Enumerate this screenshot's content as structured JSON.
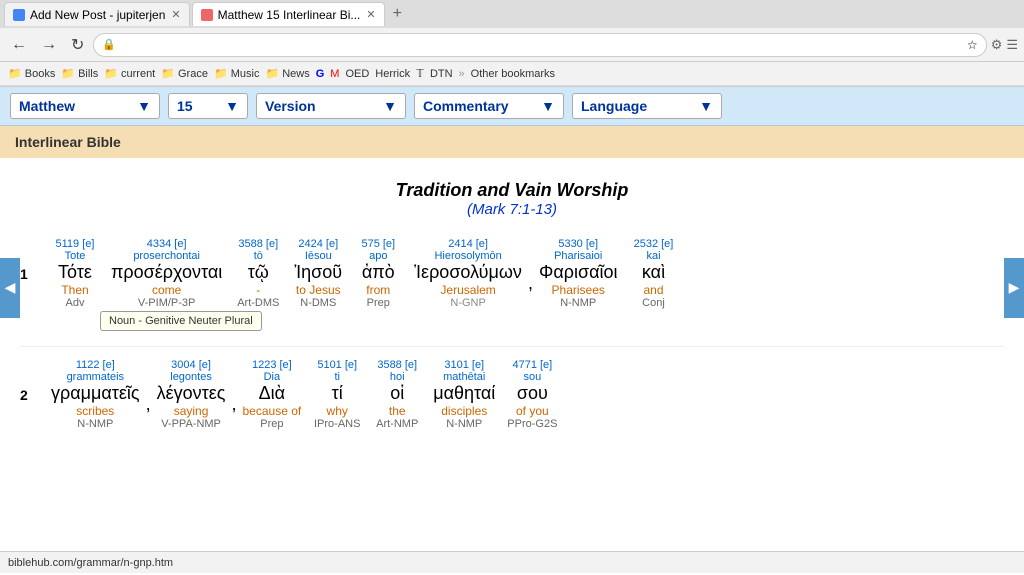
{
  "browser": {
    "tabs": [
      {
        "label": "Add New Post - jupiterjen",
        "active": false,
        "id": "tab1"
      },
      {
        "label": "Matthew 15 Interlinear Bi...",
        "active": true,
        "id": "tab2"
      }
    ],
    "address": "biblehub.com/interlinear/matthew/15.htm",
    "status_url": "biblehub.com/grammar/n-gnp.htm"
  },
  "bookmarks": [
    {
      "label": "Books"
    },
    {
      "label": "Bills"
    },
    {
      "label": "current"
    },
    {
      "label": "Grace"
    },
    {
      "label": "Music"
    },
    {
      "label": "News"
    },
    {
      "label": "OED"
    },
    {
      "label": "Herrick"
    },
    {
      "label": "DTN"
    },
    {
      "label": "Other bookmarks"
    }
  ],
  "toolbar": {
    "matthew_label": "Matthew",
    "chapter_label": "15",
    "version_label": "Version",
    "commentary_label": "Commentary",
    "language_label": "Language"
  },
  "bible_header": {
    "title": "Interlinear Bible"
  },
  "page_title": "Tradition and Vain Worship",
  "page_subtitle": "(Mark 7:1-13)",
  "verses": [
    {
      "num": "1",
      "words": [
        {
          "strongs": "5119 [e]",
          "translit": "Tote",
          "greek": "Τότε",
          "english": "Then",
          "parse": "Adv"
        },
        {
          "strongs": "4334 [e]",
          "translit": "proserchontai",
          "greek": "προσέρχονται",
          "english": "come",
          "parse": "V-PIM/P-3P"
        },
        {
          "strongs": "3588 [e]",
          "translit": "tō",
          "greek": "τῷ",
          "english": "-",
          "parse": "Art-DMS"
        },
        {
          "strongs": "2424 [e]",
          "translit": "Iēsou",
          "greek": "Ἰησοῦ",
          "english": "to Jesus",
          "parse": "N-DMS"
        },
        {
          "strongs": "575 [e]",
          "translit": "apo",
          "greek": "ἀπὸ",
          "english": "from",
          "parse": "Prep"
        },
        {
          "strongs": "2414 [e]",
          "translit": "Hierosolymōn",
          "greek": "Ἱεροσολύμων",
          "english": "Jerusalem",
          "parse": "N-GNP",
          "has_tooltip": true,
          "tooltip_text": "Noun - Genitive Neuter Plural",
          "punct": ","
        },
        {
          "strongs": "5330 [e]",
          "translit": "Pharisaioi",
          "greek": "Φαρισαῖοι",
          "english": "Pharisees",
          "parse": "N-NMP"
        },
        {
          "strongs": "2532 [e]",
          "translit": "kai",
          "greek": "καὶ",
          "english": "and",
          "parse": "Conj"
        }
      ]
    },
    {
      "num": "2",
      "words": [
        {
          "strongs": "1122 [e]",
          "translit": "grammateis",
          "greek": "γραμματεῖς",
          "english": "scribes",
          "parse": "N-NMP",
          "punct": ","
        },
        {
          "strongs": "3004 [e]",
          "translit": "legontes",
          "greek": "λέγοντες",
          "english": "saying",
          "parse": "V-PPA-NMP",
          "punct": ","
        },
        {
          "strongs": "1223 [e]",
          "translit": "Dia",
          "greek": "Διὰ",
          "english": "because of",
          "parse": "Prep"
        },
        {
          "strongs": "5101 [e]",
          "translit": "ti",
          "greek": "τί",
          "english": "why",
          "parse": "IPro-ANS"
        },
        {
          "strongs": "3588 [e]",
          "translit": "hoi",
          "greek": "οἱ",
          "english": "the",
          "parse": "Art-NMP"
        },
        {
          "strongs": "3101 [e]",
          "translit": "mathētai",
          "greek": "μαθηταί",
          "english": "disciples",
          "parse": "N-NMP"
        },
        {
          "strongs": "4771 [e]",
          "translit": "sou",
          "greek": "σου",
          "english": "of you",
          "parse": "PPro-G2S"
        }
      ]
    }
  ]
}
